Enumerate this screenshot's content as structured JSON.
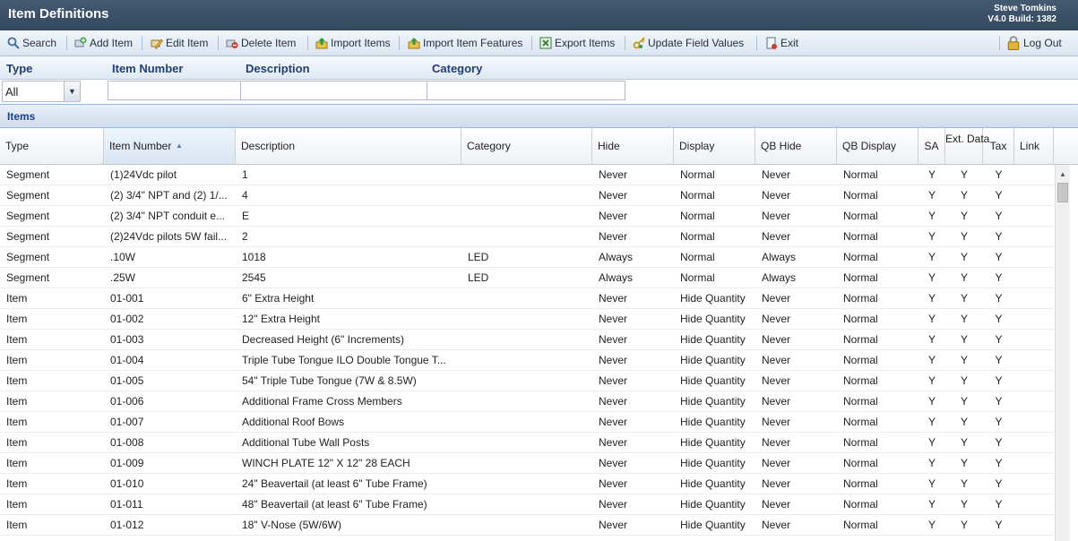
{
  "app": {
    "title": "Item Definitions",
    "user": "Steve Tomkins",
    "version": "V4.0 Build: 1382"
  },
  "toolbar": {
    "search": "Search",
    "add_item": "Add Item",
    "edit_item": "Edit Item",
    "delete_item": "Delete Item",
    "import_items": "Import Items",
    "import_item_features": "Import Item Features",
    "export_items": "Export Items",
    "update_field_values": "Update Field Values",
    "exit": "Exit",
    "log_out": "Log Out"
  },
  "filters": {
    "type_label": "Type",
    "item_number_label": "Item Number",
    "description_label": "Description",
    "category_label": "Category",
    "type_value": "All",
    "item_number_value": "",
    "description_value": "",
    "category_value": ""
  },
  "section": {
    "title": "Items"
  },
  "columns": [
    "Type",
    "Item Number",
    "Description",
    "Category",
    "Hide",
    "Display",
    "QB Hide",
    "QB Display",
    "SA",
    "Ext. Data",
    "Tax",
    "Link"
  ],
  "rows": [
    [
      "Segment",
      "(1)24Vdc pilot",
      "1",
      "",
      "Never",
      "Normal",
      "Never",
      "Normal",
      "Y",
      "Y",
      "Y",
      ""
    ],
    [
      "Segment",
      "(2) 3/4\" NPT and (2) 1/...",
      "4",
      "",
      "Never",
      "Normal",
      "Never",
      "Normal",
      "Y",
      "Y",
      "Y",
      ""
    ],
    [
      "Segment",
      "(2) 3/4\" NPT conduit e...",
      "E",
      "",
      "Never",
      "Normal",
      "Never",
      "Normal",
      "Y",
      "Y",
      "Y",
      ""
    ],
    [
      "Segment",
      "(2)24Vdc pilots 5W fail...",
      "2",
      "",
      "Never",
      "Normal",
      "Never",
      "Normal",
      "Y",
      "Y",
      "Y",
      ""
    ],
    [
      "Segment",
      ".10W",
      "1018",
      "LED",
      "Always",
      "Normal",
      "Always",
      "Normal",
      "Y",
      "Y",
      "Y",
      ""
    ],
    [
      "Segment",
      ".25W",
      "2545",
      "LED",
      "Always",
      "Normal",
      "Always",
      "Normal",
      "Y",
      "Y",
      "Y",
      ""
    ],
    [
      "Item",
      "01-001",
      "6\" Extra Height",
      "",
      "Never",
      "Hide Quantity",
      "Never",
      "Normal",
      "Y",
      "Y",
      "Y",
      ""
    ],
    [
      "Item",
      "01-002",
      "12\" Extra Height",
      "",
      "Never",
      "Hide Quantity",
      "Never",
      "Normal",
      "Y",
      "Y",
      "Y",
      ""
    ],
    [
      "Item",
      "01-003",
      "Decreased Height (6\" Increments)",
      "",
      "Never",
      "Hide Quantity",
      "Never",
      "Normal",
      "Y",
      "Y",
      "Y",
      ""
    ],
    [
      "Item",
      "01-004",
      "Triple Tube Tongue ILO Double Tongue T...",
      "",
      "Never",
      "Hide Quantity",
      "Never",
      "Normal",
      "Y",
      "Y",
      "Y",
      ""
    ],
    [
      "Item",
      "01-005",
      "54\" Triple Tube Tongue (7W & 8.5W)",
      "",
      "Never",
      "Hide Quantity",
      "Never",
      "Normal",
      "Y",
      "Y",
      "Y",
      ""
    ],
    [
      "Item",
      "01-006",
      "Additional Frame Cross Members",
      "",
      "Never",
      "Hide Quantity",
      "Never",
      "Normal",
      "Y",
      "Y",
      "Y",
      ""
    ],
    [
      "Item",
      "01-007",
      "Additional Roof Bows",
      "",
      "Never",
      "Hide Quantity",
      "Never",
      "Normal",
      "Y",
      "Y",
      "Y",
      ""
    ],
    [
      "Item",
      "01-008",
      "Additional Tube Wall Posts",
      "",
      "Never",
      "Hide Quantity",
      "Never",
      "Normal",
      "Y",
      "Y",
      "Y",
      ""
    ],
    [
      "Item",
      "01-009",
      "WINCH PLATE 12\" X 12\" 28 EACH",
      "",
      "Never",
      "Hide Quantity",
      "Never",
      "Normal",
      "Y",
      "Y",
      "Y",
      ""
    ],
    [
      "Item",
      "01-010",
      "24\" Beavertail (at least 6\" Tube Frame)",
      "",
      "Never",
      "Hide Quantity",
      "Never",
      "Normal",
      "Y",
      "Y",
      "Y",
      ""
    ],
    [
      "Item",
      "01-011",
      "48\" Beavertail (at least 6\" Tube Frame)",
      "",
      "Never",
      "Hide Quantity",
      "Never",
      "Normal",
      "Y",
      "Y",
      "Y",
      ""
    ],
    [
      "Item",
      "01-012",
      "18\" V-Nose (5W/6W)",
      "",
      "Never",
      "Hide Quantity",
      "Never",
      "Normal",
      "Y",
      "Y",
      "Y",
      ""
    ]
  ]
}
